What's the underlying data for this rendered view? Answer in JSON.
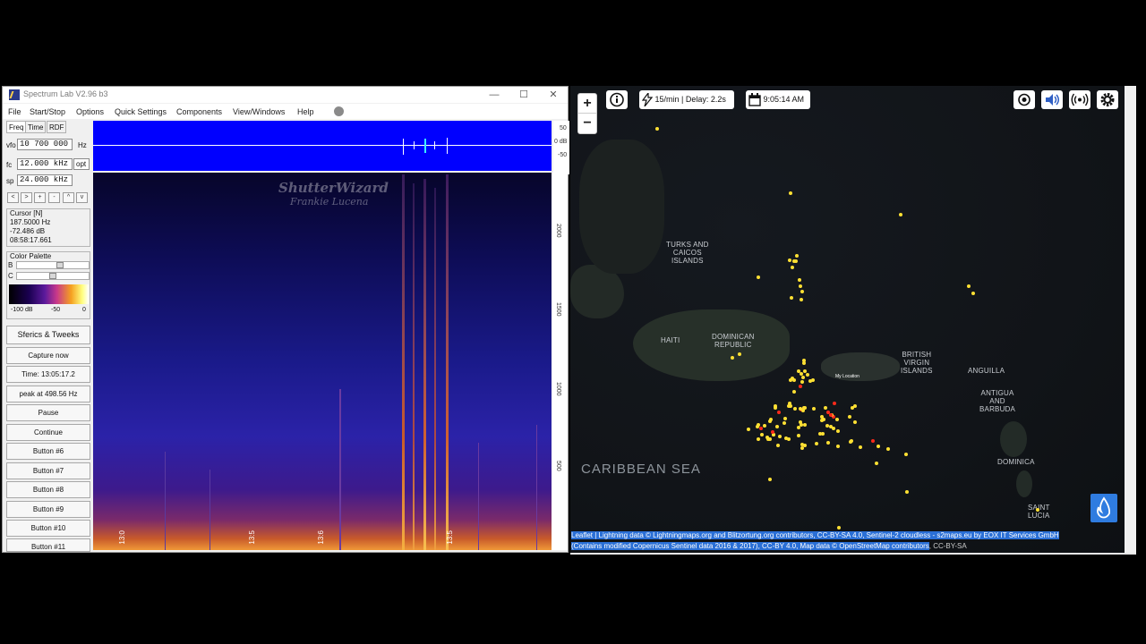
{
  "spectrum_lab": {
    "title": "Spectrum Lab V2.96 b3",
    "window_buttons": [
      "—",
      "☐",
      "✕"
    ],
    "menu": [
      "File",
      "Start/Stop",
      "Options",
      "Quick Settings",
      "Components",
      "View/Windows",
      "Help"
    ],
    "tabs": [
      "Freq",
      "Time",
      "RDF"
    ],
    "fields": {
      "vfo_label": "vfo",
      "vfo_value": "10 700 000",
      "vfo_unit": "Hz",
      "fc_label": "fc",
      "fc_value": "12.000 kHz",
      "fc_button": "opt",
      "sp_label": "sp",
      "sp_value": "24.000 kHz"
    },
    "nav_buttons": [
      "<",
      ">",
      "+",
      "-",
      "^",
      "v"
    ],
    "cursor": {
      "title": "Cursor [N]",
      "freq": "187.5000 Hz",
      "level": "-72.486 dB",
      "time": "08:58:17.661"
    },
    "palette": {
      "title": "Color Palette",
      "b_label": "B",
      "c_label": "C",
      "scale": [
        "-100 dB",
        "-50",
        "0"
      ]
    },
    "buttons": [
      "Sferics & Tweeks",
      "Capture now",
      "Time:  13:05:17.2",
      "peak at 498.56 Hz",
      "Pause",
      "Continue",
      "Button #6",
      "Button #7",
      "Button #8",
      "Button #9",
      "Button #10",
      "Button #11"
    ],
    "spectrum_scale": [
      "50",
      "0 dB",
      "-50"
    ],
    "waterfall_scale": [
      "2000",
      "1500",
      "1000",
      "500"
    ],
    "waterfall_times": [
      "13:0",
      "13:5",
      "13:6",
      "13:5"
    ],
    "watermark": [
      "ShutterWizard",
      "Frankie Lucena"
    ],
    "colors": {
      "spectrum_bg": "#0000ff",
      "waterfall_low": "#0d0c55",
      "waterfall_high": "#f09838"
    }
  },
  "map": {
    "zoom_in": "+",
    "zoom_out": "−",
    "info_icon": "info-icon",
    "rate_text": "15/min | Delay: 2.2s",
    "clock_text": "9:05:14 AM",
    "right_icons": [
      "locate-icon",
      "sound-icon",
      "signal-icon",
      "settings-icon"
    ],
    "labels": {
      "turks": "TURKS AND\nCAICOS\nISLANDS",
      "haiti": "HAITI",
      "dominican": "DOMINICAN\nREPUBLIC",
      "bvi": "BRITISH\nVIRGIN\nISLANDS",
      "anguilla": "ANGUILLA",
      "antigua": "ANTIGUA\nAND\nBARBUDA",
      "dominica": "DOMINICA",
      "saint_lucia": "SAINT\nLUCIA",
      "sea": "CARIBBEAN SEA",
      "my_location": "My Location"
    },
    "attribution_line1": "Leaflet | Lightning data © Lightningmaps.org and Blitzortung.org contributors, CC-BY-SA 4.0, Sentinel-2 cloudless - s2maps.eu by EOX IT Services GmbH",
    "attribution_line2": "(Contains modified Copernicus Sentinel data 2016 & 2017), CC-BY 4.0, Map data © OpenStreetMap contributors",
    "attribution_tail": ", CC-BY-SA",
    "colors": {
      "strike_recent": "#ffe033",
      "strike_old": "#ff2a1a",
      "accent": "#2f7ce0"
    }
  }
}
